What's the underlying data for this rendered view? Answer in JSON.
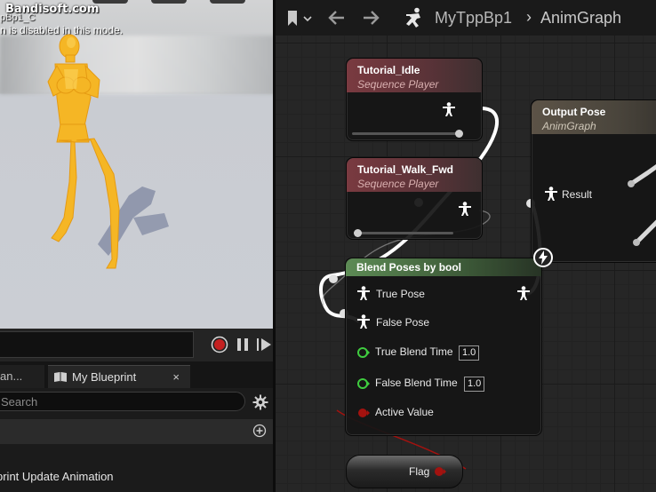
{
  "watermark": "Bandisoft.com",
  "viewport": {
    "asset_name_partial": "pBp1_C",
    "message": "n is disabled in this mode.",
    "character_color": "#f5b625"
  },
  "timeline": {
    "record_icon": "record-icon",
    "pause_icon": "pause-icon",
    "play_icon": "play-icon"
  },
  "blueprint_panel": {
    "tab_left_label": "an...",
    "tab_label": "My Blueprint",
    "tab_close": "×",
    "search_placeholder": "Search",
    "item_label": "print Update Animation"
  },
  "graph": {
    "breadcrumb_blueprint": "MyTppBp1",
    "breadcrumb_separator": "›",
    "breadcrumb_graph": "AnimGraph",
    "nodes": {
      "tutorial_idle": {
        "title": "Tutorial_Idle",
        "subtitle": "Sequence Player",
        "play_rate": 1.0
      },
      "tutorial_walk": {
        "title": "Tutorial_Walk_Fwd",
        "subtitle": "Sequence Player",
        "play_rate": 0.0
      },
      "output_pose": {
        "title": "Output Pose",
        "subtitle": "AnimGraph",
        "pin_result": "Result"
      },
      "blend_poses": {
        "title": "Blend Poses by bool",
        "pin_true_pose": "True Pose",
        "pin_false_pose": "False Pose",
        "pin_true_blend_time": "True Blend Time",
        "true_blend_time_value": "1.0",
        "pin_false_blend_time": "False Blend Time",
        "false_blend_time_value": "1.0",
        "pin_active_value": "Active Value"
      },
      "flag": {
        "label": "Flag"
      }
    },
    "colors": {
      "sequence_header": "#7a3a40",
      "output_header": "#5c5347",
      "blend_header": "#5d8b55",
      "float_pin": "#3fcc3f",
      "bool_pin": "#a3120f",
      "pose_wire": "#ffffff"
    }
  }
}
